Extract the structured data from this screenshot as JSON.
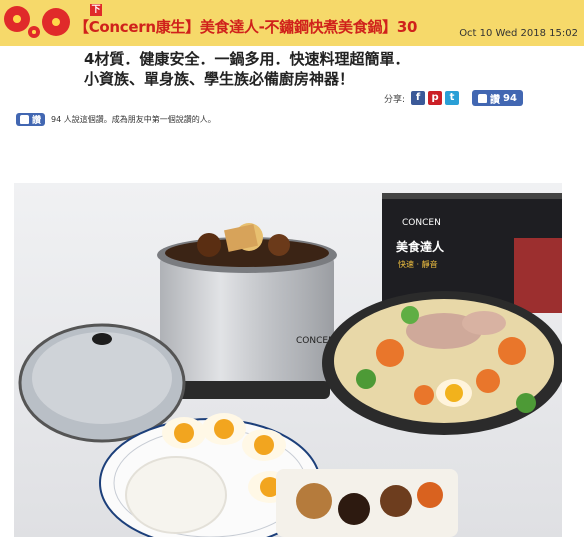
{
  "header": {
    "badge": "下",
    "title": "【Concern康生】美食達人-不鏽鋼快煮美食鍋】30",
    "date": "Oct 10 Wed 2018 15:02"
  },
  "article": {
    "line1": "4材質．健康安全．一鍋多用．快速料理超簡單．",
    "line2": "小資族、單身族、學生族必備廚房神器！"
  },
  "share": {
    "label": "分享:",
    "facebook_icon": "f",
    "plurk_icon": "p",
    "twitter_icon": "t",
    "like_label": "讚",
    "like_count": "94"
  },
  "social": {
    "like_label": "讚",
    "like_summary": "94 人說這個讚。成為朋友中第一個說讚的人。"
  },
  "photo": {
    "box_brand": "CONCEN",
    "box_text": "美食達人",
    "box_subtext": "快速 · 靜音",
    "pot_brand": "CONCEN"
  }
}
